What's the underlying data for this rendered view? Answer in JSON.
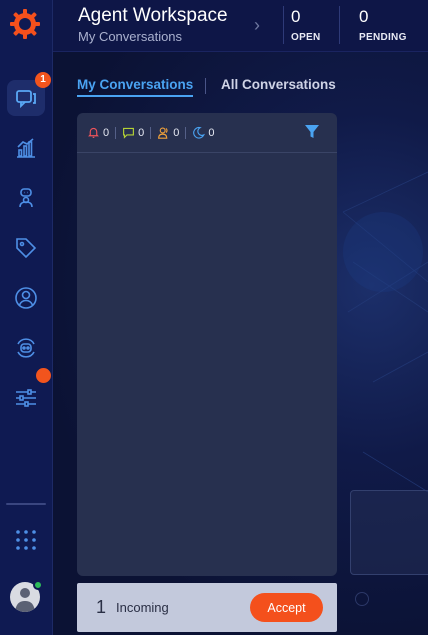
{
  "header": {
    "title": "Agent Workspace",
    "subtitle": "My Conversations",
    "stats": [
      {
        "value": "0",
        "label": "OPEN"
      },
      {
        "value": "0",
        "label": "PENDING"
      }
    ]
  },
  "sidebar": {
    "items": [
      {
        "icon": "chat-bubbles-icon",
        "badge": "1",
        "active": true
      },
      {
        "icon": "analytics-icon"
      },
      {
        "icon": "agent-icon"
      },
      {
        "icon": "tag-icon"
      },
      {
        "icon": "contact-icon"
      },
      {
        "icon": "bot-icon"
      },
      {
        "icon": "sliders-icon",
        "dot": true
      }
    ],
    "apps_icon": "grid-dots-icon",
    "user_status": "online"
  },
  "tabs": [
    {
      "label": "My Conversations",
      "active": true
    },
    {
      "label": "All Conversations",
      "active": false
    }
  ],
  "filters": [
    {
      "icon": "bell-icon",
      "count": "0",
      "color": "#f2545b"
    },
    {
      "icon": "message-icon",
      "count": "0",
      "color": "#b5d334"
    },
    {
      "icon": "users-icon",
      "count": "0",
      "color": "#f2a23a"
    },
    {
      "icon": "moon-icon",
      "count": "0",
      "color": "#4aa3f2"
    }
  ],
  "incoming": {
    "count": "1",
    "label": "Incoming",
    "accept_label": "Accept"
  },
  "colors": {
    "accent": "#4aa3f2",
    "brand_orange": "#f4501c",
    "sidebar_bg": "#0f1a52",
    "panel_bg": "#27304f"
  }
}
